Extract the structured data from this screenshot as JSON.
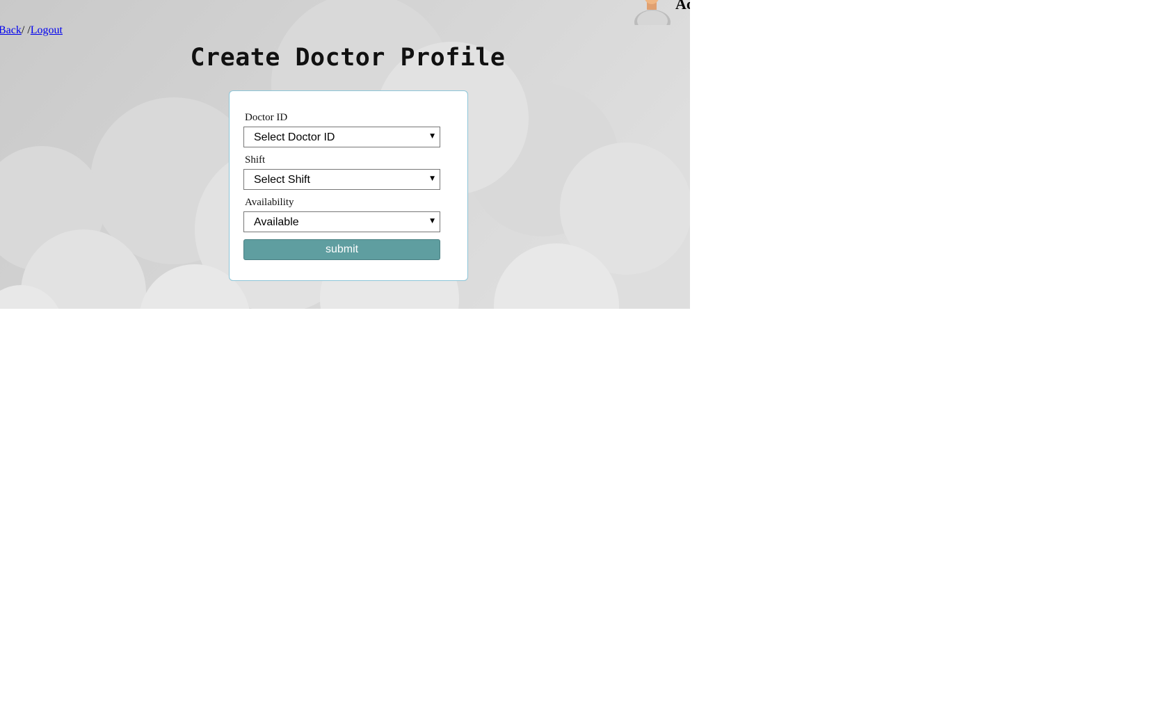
{
  "nav": {
    "back_label": "Back",
    "separator": "/ /",
    "logout_label": "Logout"
  },
  "user": {
    "avatar_icon": "user-avatar-icon",
    "name": "Ad"
  },
  "page": {
    "title": "Create Doctor Profile"
  },
  "form": {
    "fields": [
      {
        "label": "Doctor ID",
        "selected": "Select Doctor ID"
      },
      {
        "label": "Shift",
        "selected": "Select Shift"
      },
      {
        "label": "Availability",
        "selected": "Available"
      }
    ],
    "submit_label": "submit",
    "caret_icon": "chevron-down-icon"
  },
  "colors": {
    "page_background": "#ffffff",
    "hero_background": "#d2d2d2",
    "card_border": "#8cc5d8",
    "submit_background": "#5f9ea0",
    "link": "#0000ee"
  }
}
